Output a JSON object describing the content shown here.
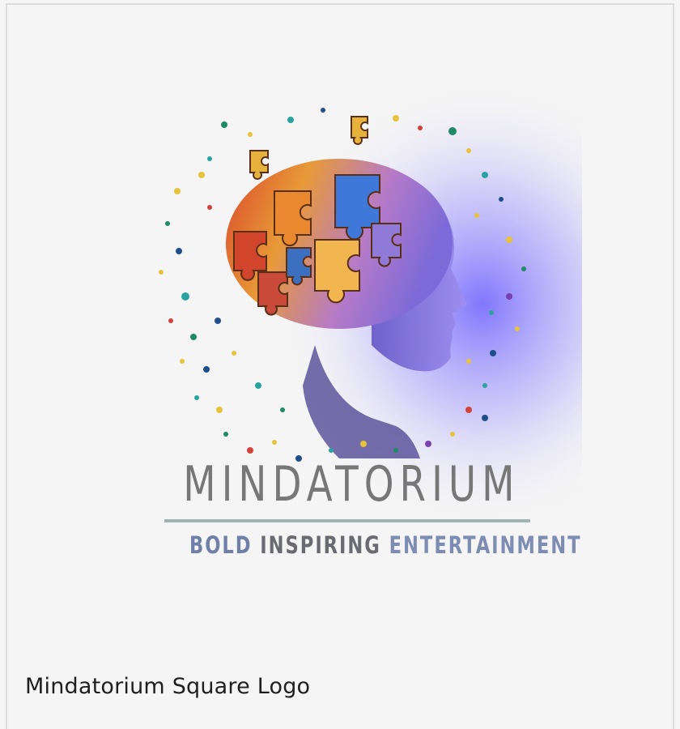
{
  "logo": {
    "wordmark": "MINDATORIUM",
    "tagline": [
      "BOLD",
      "INSPIRING",
      "ENTERTAINMENT"
    ],
    "colors": {
      "wordmark": "#777777",
      "rule": "#9fb3b0",
      "tagline_blue": "#6f7fa8",
      "tagline_gray": "#6a6a72",
      "glow": "#5a4cff"
    }
  },
  "caption": "Mindatorium Square Logo"
}
